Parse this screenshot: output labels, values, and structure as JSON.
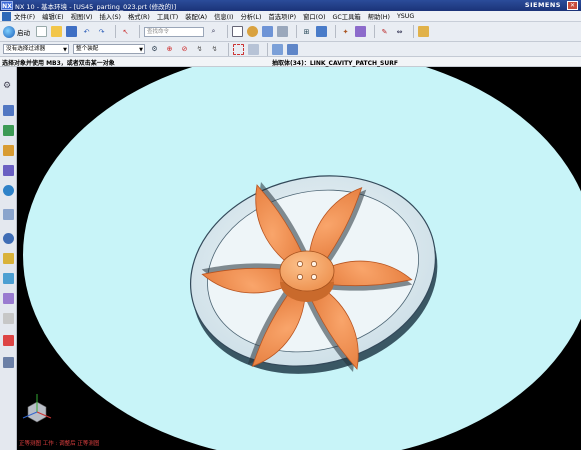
{
  "titlebar": {
    "logo": "NX",
    "title": "NX 10 - 基本环境 - [US45_parting_023.prt (修改的)]",
    "brand": "SIEMENS"
  },
  "menubar": {
    "items": [
      "文件(F)",
      "编辑(E)",
      "视图(V)",
      "插入(S)",
      "格式(R)",
      "工具(T)",
      "装配(A)",
      "信息(I)",
      "分析(L)",
      "首选项(P)",
      "窗口(O)",
      "GC工具箱",
      "帮助(H)",
      "YSUG"
    ]
  },
  "toolbar1": {
    "start_label": "启动",
    "search_placeholder": "查找命令"
  },
  "toolbar2": {
    "filter_value": "没有选择过滤器",
    "scope_value": "整个装配"
  },
  "statusline": {
    "prompt": "选择对象并使用 MB3，或者双击某一对象",
    "status": "抽取体(34)：LINK_CAVITY_PATCH_SURF"
  },
  "graphics": {
    "view_info": "正等测图 工作 : 调整后 正等测图"
  },
  "colors": {
    "background": "#000000",
    "sphere": "#c8f4f8",
    "mold": "#e6f0f4",
    "blades": "#f08a4b",
    "hub": "#f6a86a"
  },
  "icons": {
    "close": "close-icon",
    "start": "start-icon",
    "triad": "wcs-triad-icon"
  }
}
